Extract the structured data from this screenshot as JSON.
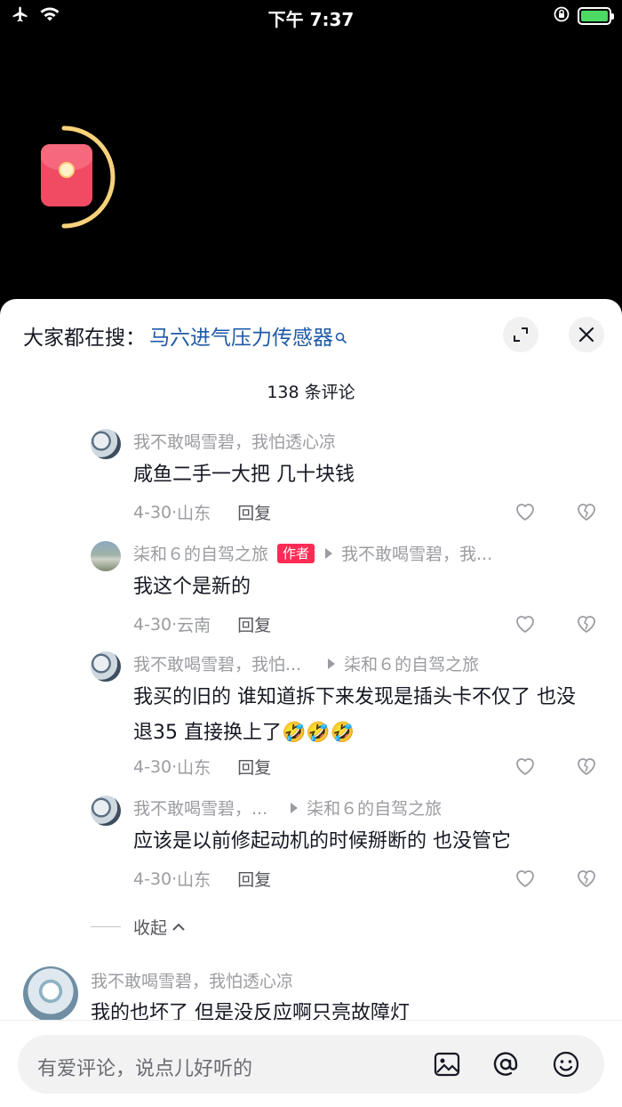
{
  "status_bar": {
    "time": "下午 7:37",
    "icons": [
      "airplane-icon",
      "wifi-icon",
      "rotation-lock-icon",
      "battery-charging-icon"
    ]
  },
  "colors": {
    "accent_link": "#1e5aa8",
    "author_tag": "#fe2c55",
    "battery": "#4cd964"
  },
  "panel": {
    "search_label": "大家都在搜：",
    "search_term": "马六进气压力传感器",
    "comment_count": "138 条评论"
  },
  "replies": [
    {
      "user": "我不敢喝雪碧，我怕透心凉",
      "author_tag": "",
      "reply_to": "",
      "text": "咸鱼二手一大把  几十块钱",
      "date": "4-30",
      "location": "山东",
      "reply_label": "回复"
    },
    {
      "user": "柒和６的自驾之旅",
      "author_tag": "作者",
      "reply_to": "我不敢喝雪碧，我...",
      "text": "我这个是新的",
      "date": "4-30",
      "location": "云南",
      "reply_label": "回复"
    },
    {
      "user": "我不敢喝雪碧，我怕...",
      "author_tag": "",
      "reply_to": "柒和６的自驾之旅",
      "text": "我买的旧的  谁知道拆下来发现是插头卡不仅了 也没退35  直接换上了🤣🤣🤣",
      "date": "4-30",
      "location": "山东",
      "reply_label": "回复"
    },
    {
      "user": "我不敢喝雪碧，...",
      "author_tag": "",
      "reply_to": "柒和６的自驾之旅",
      "text": "应该是以前修起动机的时候掰断的  也没管它",
      "date": "4-30",
      "location": "山东",
      "reply_label": "回复"
    }
  ],
  "collapse_label": "收起",
  "next_comment": {
    "user": "我不敢喝雪碧，我怕透心凉",
    "text": "我的也坏了  但是没反应啊只亮故障灯"
  },
  "input": {
    "placeholder": "有爱评论，说点儿好听的",
    "icons": [
      "image-icon",
      "mention-icon",
      "emoji-icon"
    ]
  }
}
